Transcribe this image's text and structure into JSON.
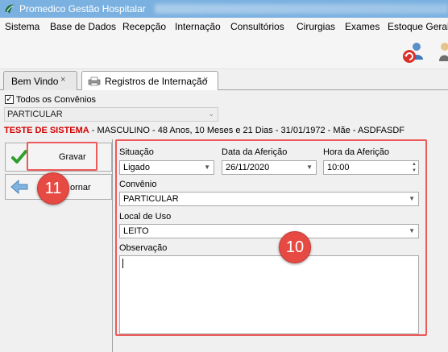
{
  "window": {
    "title": "Promedico Gestão Hospitalar"
  },
  "menu": [
    {
      "label": "Sistema"
    },
    {
      "label": "Base de Dados"
    },
    {
      "label": "Recepção"
    },
    {
      "label": "Internação"
    },
    {
      "label": "Consultórios"
    },
    {
      "label": "Cirurgias"
    },
    {
      "label": "Exames"
    },
    {
      "label": "Estoque Geral"
    }
  ],
  "tabs": [
    {
      "label": "Bem Vindo",
      "close": "×"
    },
    {
      "label": "Registros de Internação",
      "close": "×"
    }
  ],
  "filter": {
    "all_conventions_label": "Todos os Convênios",
    "all_conventions_checked": true,
    "convention_value": "PARTICULAR"
  },
  "patient": {
    "name": "TESTE DE SISTEMA",
    "details": " - MASCULINO - 48 Anos, 10 Meses e 21 Dias - 31/01/1972 - Mãe - ASDFASDF"
  },
  "actions": {
    "save_label": "Gravar",
    "return_label": "ornar"
  },
  "form": {
    "situacao_label": "Situação",
    "situacao_value": "Ligado",
    "data_label": "Data da Aferição",
    "data_value": "26/11/2020",
    "hora_label": "Hora da Aferição",
    "hora_value": "10:00",
    "convenio_label": "Convênio",
    "convenio_value": "PARTICULAR",
    "local_label": "Local de Uso",
    "local_value": "LEITO",
    "obs_label": "Observação",
    "obs_value": ""
  },
  "annotations": {
    "badge_form": "10",
    "badge_save": "11"
  },
  "colors": {
    "titlebar": "#7bb1e0",
    "highlight": "#ec5a5a",
    "patient_name": "#d40000",
    "badge": "#e74a43"
  }
}
